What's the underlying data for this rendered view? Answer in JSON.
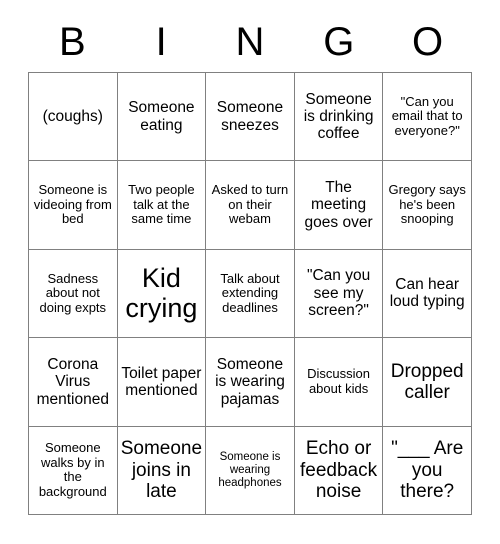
{
  "card": {
    "title": "BINGO",
    "header_letters": [
      "B",
      "I",
      "N",
      "G",
      "O"
    ],
    "grid_size": "5x5",
    "colors": {
      "text": "#000000",
      "background": "#ffffff",
      "grid_line": "#808080"
    },
    "rows": [
      [
        {
          "text": "(coughs)",
          "size": "fs-m"
        },
        {
          "text": "Someone eating",
          "size": "fs-m"
        },
        {
          "text": "Someone sneezes",
          "size": "fs-m"
        },
        {
          "text": "Someone is drinking coffee",
          "size": "fs-m"
        },
        {
          "text": "\"Can you email that to everyone?\"",
          "size": "fs-s"
        }
      ],
      [
        {
          "text": "Someone is videoing from bed",
          "size": "fs-s"
        },
        {
          "text": "Two people talk at the same time",
          "size": "fs-s"
        },
        {
          "text": "Asked to turn on their webam",
          "size": "fs-s"
        },
        {
          "text": "The meeting goes over",
          "size": "fs-m"
        },
        {
          "text": "Gregory says he's been snooping",
          "size": "fs-s"
        }
      ],
      [
        {
          "text": "Sadness about not doing expts",
          "size": "fs-s"
        },
        {
          "text": "Kid crying",
          "size": "fs-xl"
        },
        {
          "text": "Talk about extending deadlines",
          "size": "fs-s"
        },
        {
          "text": "\"Can you see my screen?\"",
          "size": "fs-m"
        },
        {
          "text": "Can hear loud typing",
          "size": "fs-m"
        }
      ],
      [
        {
          "text": "Corona Virus mentioned",
          "size": "fs-m"
        },
        {
          "text": "Toilet paper mentioned",
          "size": "fs-m"
        },
        {
          "text": "Someone is wearing pajamas",
          "size": "fs-m"
        },
        {
          "text": "Discussion about kids",
          "size": "fs-s"
        },
        {
          "text": "Dropped caller",
          "size": "fs-l"
        }
      ],
      [
        {
          "text": "Someone walks by in the background",
          "size": "fs-s"
        },
        {
          "text": "Someone joins in late",
          "size": "fs-l"
        },
        {
          "text": "Someone is wearing headphones",
          "size": "fs-xs"
        },
        {
          "text": "Echo or feedback noise",
          "size": "fs-l"
        },
        {
          "text": "\"___ Are you there?",
          "size": "fs-l"
        }
      ]
    ]
  }
}
